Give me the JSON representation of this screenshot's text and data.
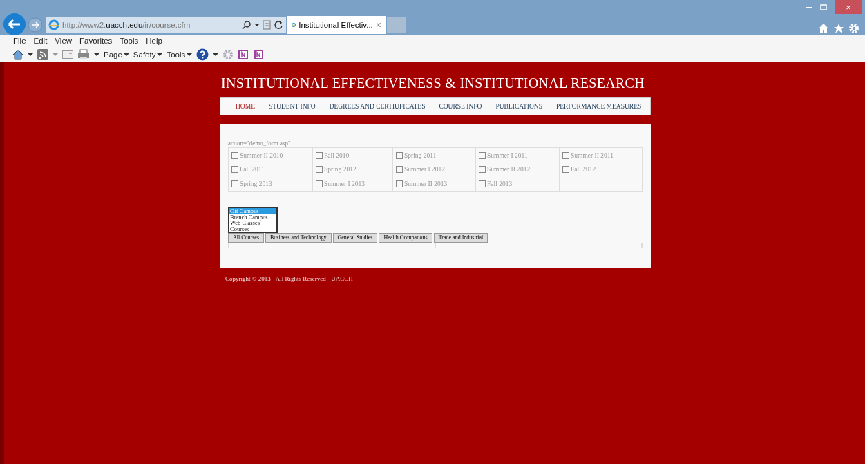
{
  "browser": {
    "url": "http://www2.**uacch.edu**/ir/course.cfm",
    "tab": {
      "title": "Institutional Effectiv...",
      "close": "×"
    },
    "window_close": "×",
    "menu": [
      "File",
      "Edit",
      "View",
      "Favorites",
      "Tools",
      "Help"
    ],
    "toolbar": [
      "Page",
      "Safety",
      "Tools"
    ]
  },
  "site_title": "INSTITUTIONAL EFFECTIVENESS & INSTITUTIONAL RESEARCH",
  "nav": [
    {
      "label": "HOME",
      "selected": true
    },
    {
      "label": "STUDENT INFO",
      "selected": false
    },
    {
      "label": "DEGREES AND CERTIUFICATES",
      "selected": false
    },
    {
      "label": "COURSE INFO",
      "selected": false
    },
    {
      "label": "PUBLICATIONS",
      "selected": false
    },
    {
      "label": "PERFORMANCE MEASURES",
      "selected": false
    }
  ],
  "form_note": "action=\"demo_form.asp\"",
  "terms": [
    {
      "label": "Summer II 2010",
      "checked": false
    },
    {
      "label": "Fall 2010",
      "checked": false
    },
    {
      "label": "Spring 2011",
      "checked": false
    },
    {
      "label": "Summer I 2011",
      "checked": false
    },
    {
      "label": "Summer II 2011",
      "checked": false
    },
    {
      "label": "Fall 2011",
      "checked": false
    },
    {
      "label": "Spring 2012",
      "checked": false
    },
    {
      "label": "Summer I 2012",
      "checked": false
    },
    {
      "label": "Summer II 2012",
      "checked": false
    },
    {
      "label": "Fall 2012",
      "checked": false
    },
    {
      "label": "Spring 2013",
      "checked": false
    },
    {
      "label": "Summer I 2013",
      "checked": false
    },
    {
      "label": "Summer II 2013",
      "checked": false
    },
    {
      "label": "Fall 2013",
      "checked": false
    }
  ],
  "campus_list": [
    {
      "label": "Off Campus",
      "selected": true
    },
    {
      "label": "Branch Campus",
      "selected": false
    },
    {
      "label": "Web Classes",
      "selected": false
    },
    {
      "label": "Courses",
      "selected": false
    }
  ],
  "course_tabs": [
    {
      "label": "All Courses",
      "selected": false
    },
    {
      "label": "Business and Technology",
      "selected": false
    },
    {
      "label": "General Studies",
      "selected": false
    },
    {
      "label": "Health Occupations",
      "selected": false
    },
    {
      "label": "Trade and Industrial",
      "selected": false
    }
  ],
  "footer": "Copyright © 2013 - All Rights Reserved - UACCH"
}
